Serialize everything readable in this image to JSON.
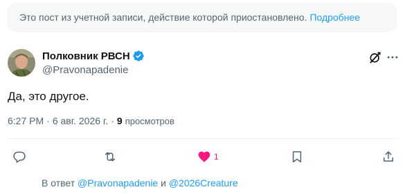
{
  "notice": {
    "text": "Это пост из учетной записи, действие которой приостановлено.",
    "link": "Подробнее"
  },
  "author": {
    "name": "Полковник РВСН",
    "handle": "@Pravonapadenie",
    "verified": true
  },
  "tweet": {
    "text": "Да, это другое."
  },
  "meta": {
    "time": "6:27 PM",
    "sep1": "·",
    "date": "6 авг. 2026 г.",
    "sep2": "·",
    "views_count": "9",
    "views_label": "просмотров"
  },
  "actions": {
    "like_count": "1"
  },
  "reply_info": {
    "prefix": "В ответ",
    "mention1": "@Pravonapadenie",
    "conj": "и",
    "mention2": "@2026Creature"
  },
  "colors": {
    "accent": "#1d9bf0",
    "like": "#f91880",
    "muted": "#536471",
    "text": "#0f1419"
  }
}
